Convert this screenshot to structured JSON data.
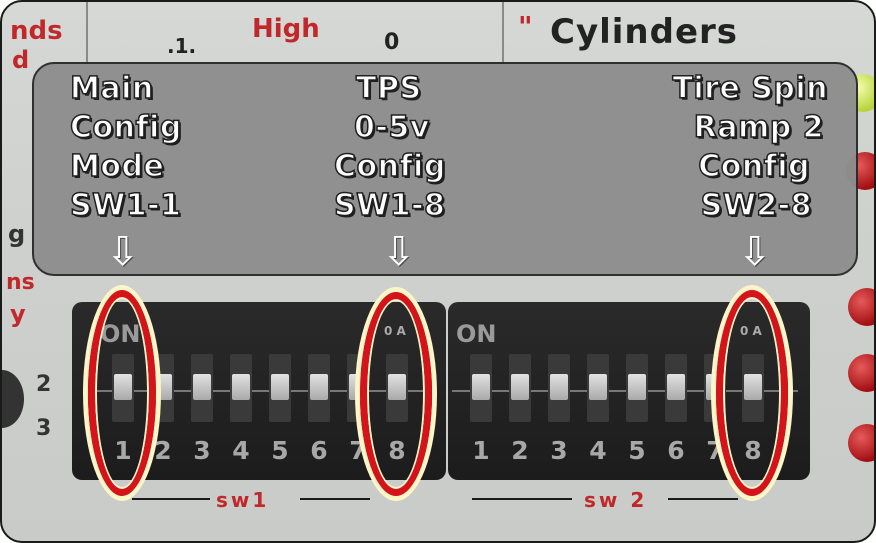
{
  "background": {
    "top_left_text_1": "nds",
    "top_left_text_2": "d",
    "high_label": "High",
    "high_scale": ".1.",
    "high_zero": "0",
    "cylinders_label": "Cylinders",
    "cylinders_mark": "\"",
    "left_fragment_1": "g",
    "left_fragment_2": "ns",
    "left_fragment_3": "y",
    "left_dial_2": "2",
    "left_dial_3": "3"
  },
  "callout": {
    "columns": [
      {
        "lines": [
          "Main",
          "Config",
          "Mode",
          "SW1-1"
        ]
      },
      {
        "lines": [
          "TPS",
          "0-5v",
          "Config",
          "SW1-8"
        ]
      },
      {
        "lines": [
          "Tire Spin",
          "Ramp 2",
          "Config",
          "SW2-8"
        ]
      }
    ],
    "arrow_glyph": "⇩"
  },
  "switches": {
    "sw1": {
      "on_label": "ON",
      "numbers": [
        "1",
        "2",
        "3",
        "4",
        "5",
        "6",
        "7",
        "8"
      ],
      "label": "sw1",
      "small_mark": "0 A"
    },
    "sw2": {
      "on_label": "ON",
      "numbers": [
        "1",
        "2",
        "3",
        "4",
        "5",
        "6",
        "7",
        "8"
      ],
      "label": "sw 2",
      "small_mark": "0 A"
    }
  },
  "colors": {
    "highlight_ring": "#d4141a",
    "ring_glow": "#fbf5c8",
    "label_red": "#c0282a",
    "led_red": "#b0161a"
  }
}
